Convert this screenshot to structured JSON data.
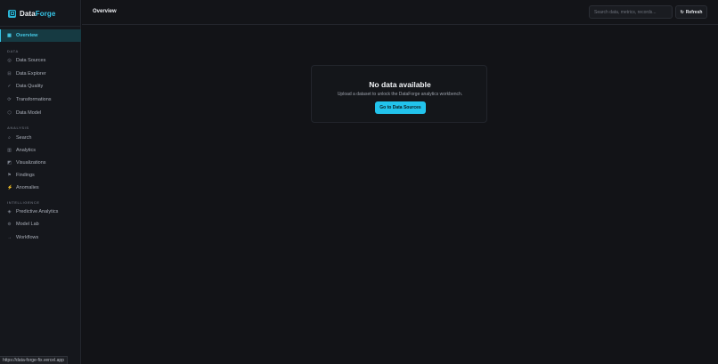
{
  "brand": {
    "name_main": "Data",
    "name_accent": "Forge"
  },
  "sidebar": {
    "active": {
      "label": "Overview",
      "icon": "grid-icon"
    },
    "sections": [
      {
        "label": "DATA",
        "items": [
          {
            "label": "Data Sources",
            "icon": "database-icon"
          },
          {
            "label": "Data Explorer",
            "icon": "table-icon"
          },
          {
            "label": "Data Quality",
            "icon": "check-icon"
          },
          {
            "label": "Transformations",
            "icon": "transform-icon"
          },
          {
            "label": "Data Model",
            "icon": "model-icon"
          }
        ]
      },
      {
        "label": "ANALYSIS",
        "items": [
          {
            "label": "Search",
            "icon": "search-icon"
          },
          {
            "label": "Analytics",
            "icon": "bar-chart-icon"
          },
          {
            "label": "Visualizations",
            "icon": "image-icon"
          },
          {
            "label": "Findings",
            "icon": "flag-icon"
          },
          {
            "label": "Anomalies",
            "icon": "lightning-icon"
          }
        ]
      },
      {
        "label": "INTELLIGENCE",
        "items": [
          {
            "label": "Predictive Analytics",
            "icon": "sparkle-icon"
          },
          {
            "label": "Model Lab",
            "icon": "lab-icon"
          },
          {
            "label": "Workflows",
            "icon": "arrow-icon"
          }
        ]
      }
    ]
  },
  "header": {
    "title": "Overview",
    "search_placeholder": "Search data, metrics, records...",
    "refresh_label": "Refresh"
  },
  "empty_state": {
    "title": "No data available",
    "description": "Upload a dataset to unlock the DataForge analytics workbench.",
    "cta_label": "Go to Data Sources"
  },
  "status_bar": {
    "url": "https://data-forge-fix.vercel.app"
  },
  "colors": {
    "accent": "#22c3ec",
    "background": "#121317",
    "sidebar": "#15171c"
  }
}
